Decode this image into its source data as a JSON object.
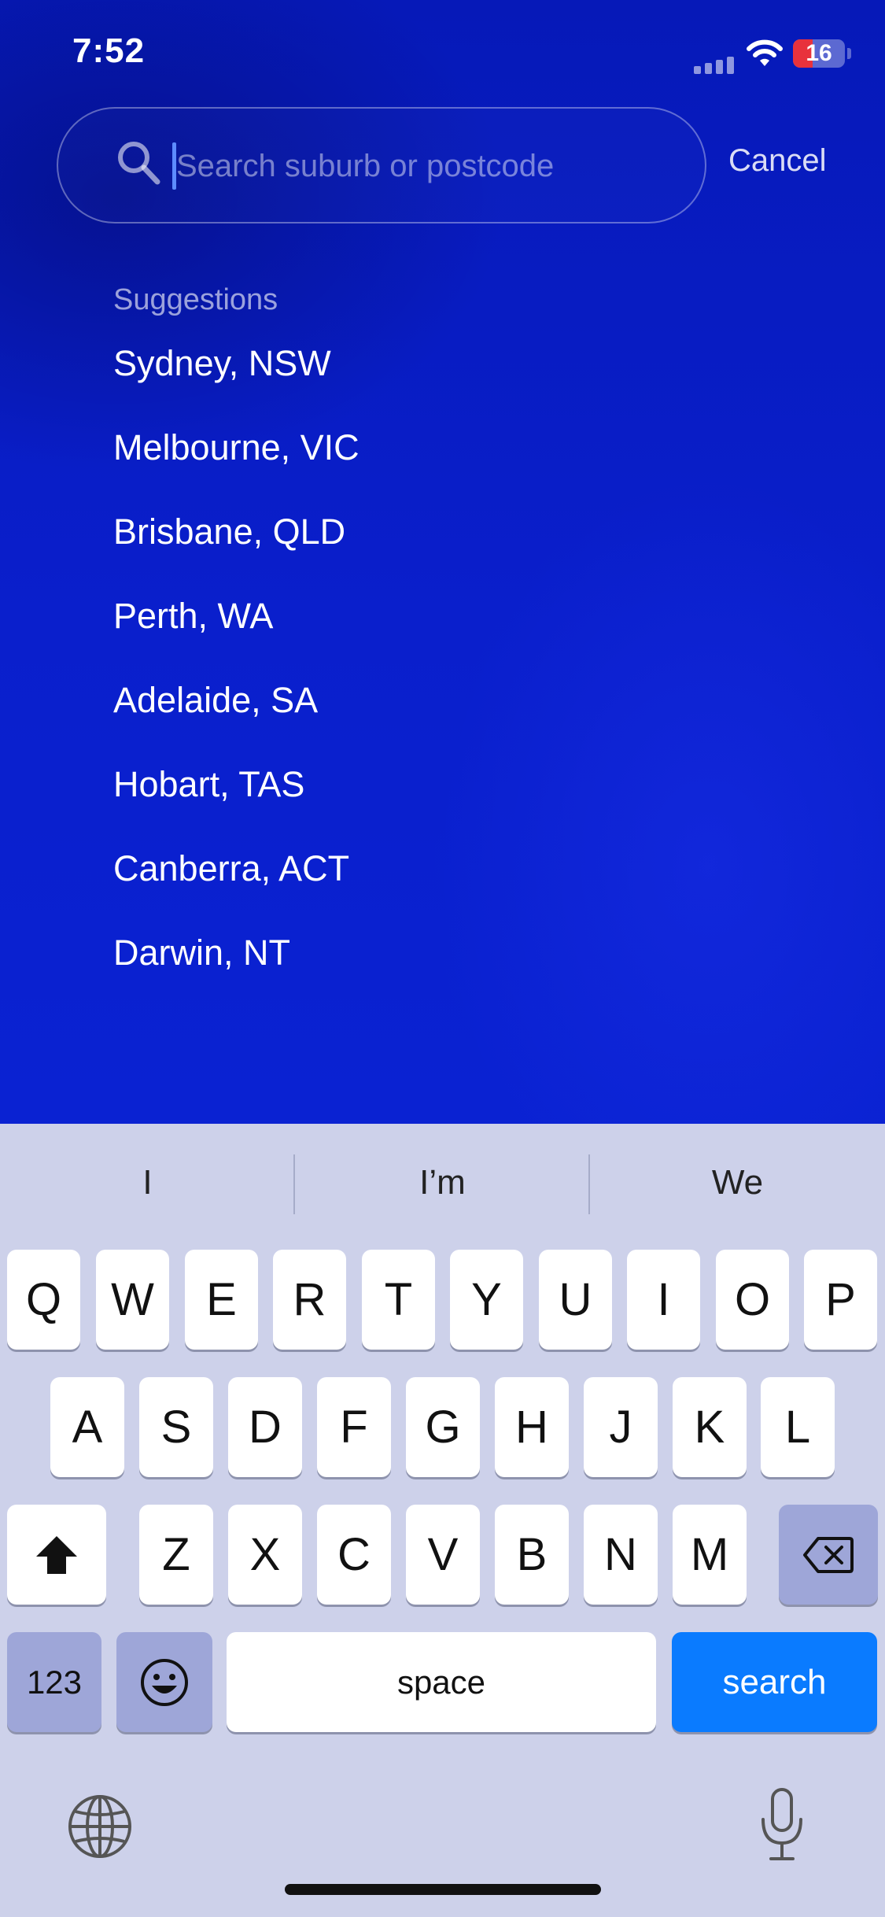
{
  "status_bar": {
    "time": "7:52",
    "battery": "16"
  },
  "search": {
    "placeholder": "Search suburb or postcode",
    "cancel_label": "Cancel"
  },
  "suggestions": {
    "header": "Suggestions",
    "items": [
      "Sydney, NSW",
      "Melbourne, VIC",
      "Brisbane, QLD",
      "Perth, WA",
      "Adelaide, SA",
      "Hobart, TAS",
      "Canberra, ACT",
      "Darwin, NT"
    ]
  },
  "keyboard": {
    "predictions": [
      "I",
      "I’m",
      "We"
    ],
    "row1": [
      "Q",
      "W",
      "E",
      "R",
      "T",
      "Y",
      "U",
      "I",
      "O",
      "P"
    ],
    "row2": [
      "A",
      "S",
      "D",
      "F",
      "G",
      "H",
      "J",
      "K",
      "L"
    ],
    "row3": [
      "Z",
      "X",
      "C",
      "V",
      "B",
      "N",
      "M"
    ],
    "numbers_label": "123",
    "space_label": "space",
    "search_label": "search"
  },
  "colors": {
    "background": "#0a1cc4",
    "search_key": "#0a7bff",
    "keyboard": "#cdd1ea"
  }
}
